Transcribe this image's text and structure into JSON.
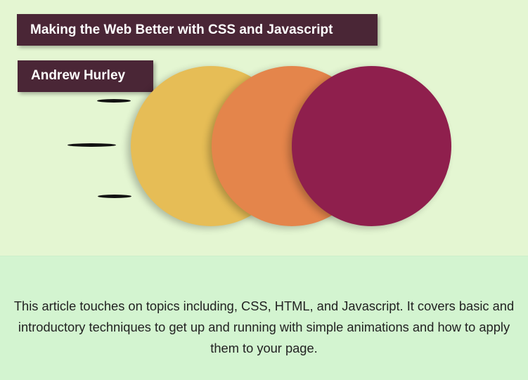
{
  "header": {
    "title": "Making the Web Better with CSS and Javascript",
    "author": "Andrew Hurley"
  },
  "illustration": {
    "circles": [
      {
        "name": "yellow-circle",
        "color": "#e6bd56"
      },
      {
        "name": "orange-circle",
        "color": "#e4854b"
      },
      {
        "name": "maroon-circle",
        "color": "#8f1f4d"
      }
    ]
  },
  "summary": {
    "text": "This article touches on topics including, CSS, HTML, and Javascript. It covers basic and introductory techniques to get up and running with simple animations and how to apply them to your page."
  },
  "colors": {
    "hero_background": "#e4f6d2",
    "footer_background": "#d3f4d0",
    "tag_background": "#4a2636"
  }
}
